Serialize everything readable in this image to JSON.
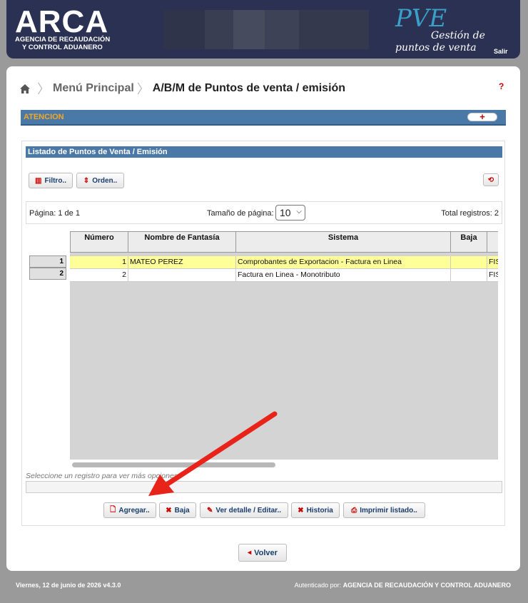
{
  "header": {
    "brand": "ARCA",
    "brand_sub_line1": "AGENCIA DE RECAUDACIÓN",
    "brand_sub_line2": "Y CONTROL ADUANERO",
    "app_name": "PVE",
    "app_sub_line1": "Gestión de",
    "app_sub_line2": "puntos de venta",
    "logout": "Salir"
  },
  "breadcrumb": {
    "menu": "Menú Principal",
    "current": "A/B/M de Puntos de venta / emisión",
    "help": "?"
  },
  "atencion": {
    "label": "ATENCION",
    "toggle": "+"
  },
  "list": {
    "title": "Listado de Puntos de Venta / Emisión",
    "filter_button": "Filtro..",
    "order_button": "Orden..",
    "pager": {
      "page_text": "Página: 1 de 1",
      "page_size_label": "Tamaño de página:",
      "page_size_value": "10",
      "total_text": "Total registros: 2"
    },
    "columns": [
      "Número",
      "Nombre de Fantasía",
      "Sistema",
      "Baja",
      ""
    ],
    "row_numbers": [
      "1",
      "2"
    ],
    "rows": [
      {
        "numero": "1",
        "nombre": "MATEO PEREZ",
        "sistema": "Comprobantes de Exportacion - Factura en Linea",
        "baja": "",
        "extra": "FIS"
      },
      {
        "numero": "2",
        "nombre": "",
        "sistema": "Factura en Linea - Monotributo",
        "baja": "",
        "extra": "FIS"
      }
    ],
    "hint": "Seleccione un registro para ver más opciones",
    "actions": {
      "agregar": "Agregar..",
      "baja": "Baja",
      "ver_detalle": "Ver detalle / Editar..",
      "historia": "Historia",
      "imprimir": "Imprimir listado.."
    }
  },
  "volver": "Volver",
  "footer": {
    "date_version": "Viernes, 12 de junio de 2026 v4.3.0",
    "auth_label": "Autenticado por:",
    "auth_value": "AGENCIA DE RECAUDACIÓN Y CONTROL ADUANERO"
  },
  "colors": {
    "header_bg": "#2b3152",
    "accent_blue": "#4a79a8",
    "attention_orange": "#f5a623",
    "selected_row": "#ffff99",
    "arrow_red": "#e8231a"
  }
}
